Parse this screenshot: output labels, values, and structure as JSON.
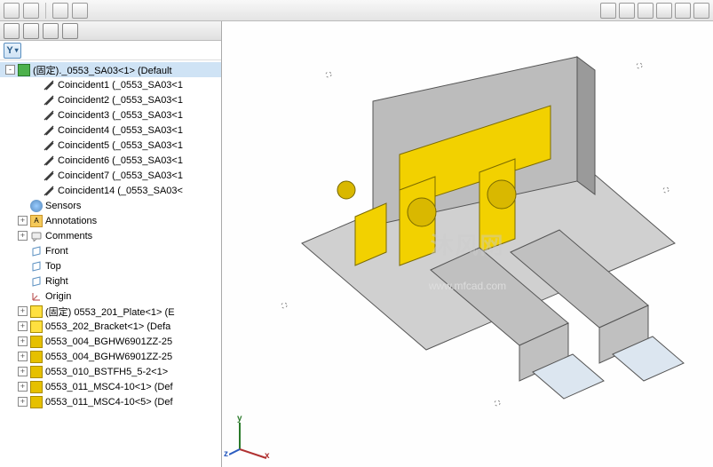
{
  "toolbar": {
    "view_tools": [
      "zoom-fit",
      "zoom-area",
      "zoom-window",
      "rotate",
      "pan",
      "section"
    ]
  },
  "filter": {
    "label": "Y"
  },
  "tree": {
    "root": {
      "label": "(固定)._0553_SA03<1> (Default",
      "expanded": true
    },
    "mates": [
      {
        "label": "Coincident1 (_0553_SA03<1"
      },
      {
        "label": "Coincident2 (_0553_SA03<1"
      },
      {
        "label": "Coincident3 (_0553_SA03<1"
      },
      {
        "label": "Coincident4 (_0553_SA03<1"
      },
      {
        "label": "Coincident5 (_0553_SA03<1"
      },
      {
        "label": "Coincident6 (_0553_SA03<1"
      },
      {
        "label": "Coincident7 (_0553_SA03<1"
      },
      {
        "label": "Coincident14 (_0553_SA03<"
      }
    ],
    "sensors": {
      "label": "Sensors"
    },
    "annotations": {
      "label": "Annotations",
      "glyph": "A"
    },
    "comments": {
      "label": "Comments"
    },
    "planes": [
      {
        "label": "Front"
      },
      {
        "label": "Top"
      },
      {
        "label": "Right"
      }
    ],
    "origin": {
      "label": "Origin"
    },
    "components": [
      {
        "label": "(固定) 0553_201_Plate<1> (E"
      },
      {
        "label": "0553_202_Bracket<1> (Defa"
      },
      {
        "label": "0553_004_BGHW6901ZZ-25"
      },
      {
        "label": "0553_004_BGHW6901ZZ-25"
      },
      {
        "label": "0553_010_BSTFH5_5-2<1>"
      },
      {
        "label": "0553_011_MSC4-10<1> (Def"
      },
      {
        "label": "0553_011_MSC4-10<5> (Def"
      }
    ]
  },
  "watermark": {
    "main": "沐风网",
    "url": "www.mfcad.com"
  },
  "triad": {
    "x": "x",
    "y": "y",
    "z": "z"
  }
}
